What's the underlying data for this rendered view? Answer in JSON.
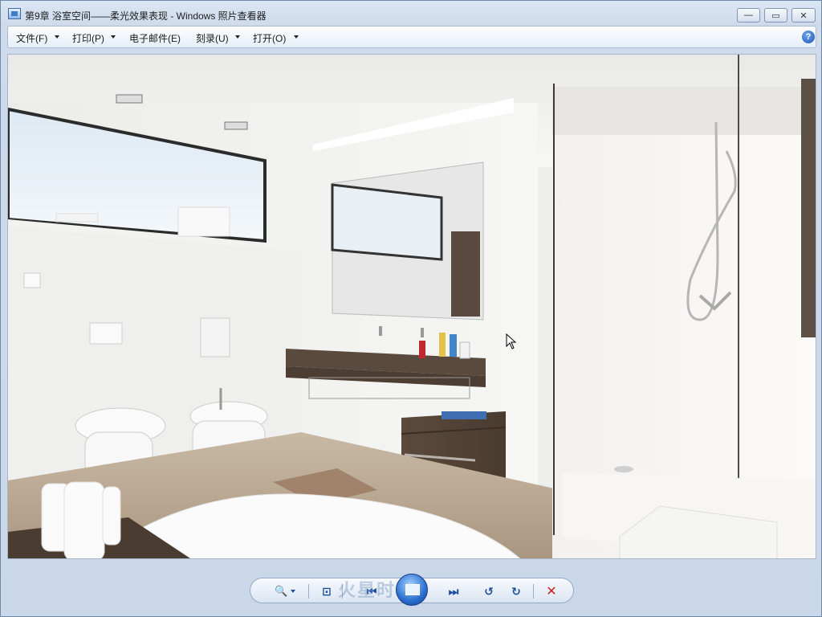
{
  "window": {
    "title": "第9章  浴室空间——柔光效果表现 - Windows 照片查看器",
    "min_glyph": "—",
    "max_glyph": "▭",
    "close_glyph": "✕"
  },
  "menu": [
    {
      "label": "文件(F)",
      "has_dropdown": true
    },
    {
      "label": "打印(P)",
      "has_dropdown": true
    },
    {
      "label": "电子邮件(E)",
      "has_dropdown": false
    },
    {
      "label": "刻录(U)",
      "has_dropdown": true
    },
    {
      "label": "打开(O)",
      "has_dropdown": true
    }
  ],
  "help": {
    "glyph": "?"
  },
  "controls": {
    "zoom_icon": "magnifier-icon",
    "fit_icon": "actual-size-icon",
    "prev_icon": "previous-icon",
    "slideshow_icon": "slideshow-icon",
    "next_icon": "next-icon",
    "rotate_ccw_icon": "rotate-counterclockwise-icon",
    "rotate_cw_icon": "rotate-clockwise-icon",
    "delete_icon": "delete-icon",
    "zoom_glyph": "🔍",
    "fit_glyph": "⊡",
    "prev_glyph": "⏮",
    "next_glyph": "⏭",
    "rotate_ccw_glyph": "↺",
    "rotate_cw_glyph": "↻",
    "delete_glyph": "✕"
  },
  "watermark": "火星时代",
  "colors": {
    "frame": "#cfdcec",
    "accent": "#1f4f9b",
    "delete": "#c8211b"
  }
}
